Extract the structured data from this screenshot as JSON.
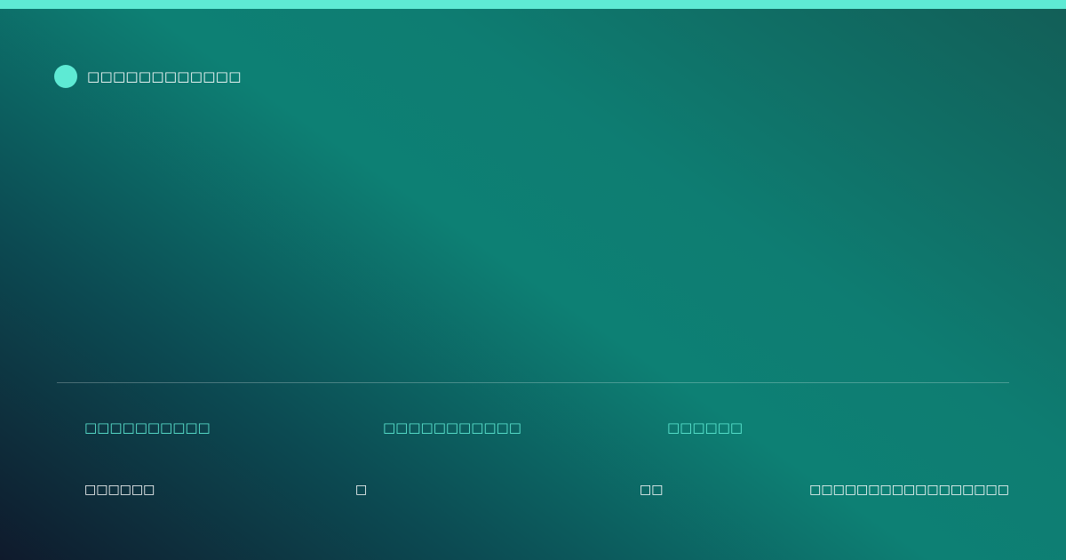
{
  "brand": {
    "name": "□□□□□□□□□□□□",
    "accent_color": "#5eead4"
  },
  "meta": {
    "labels": [
      "□□□□□□□□□□",
      "□□□□□□□□□□□",
      "□□□□□□"
    ],
    "values": [
      "□□□□□□",
      "□",
      "□□",
      "□□□□□□□□□□□□□□□□□"
    ]
  }
}
